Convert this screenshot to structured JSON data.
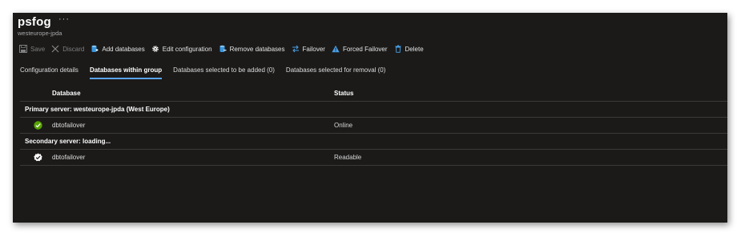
{
  "header": {
    "title": "psfog",
    "more_label": "···",
    "subtitle": "westeurope-jpda"
  },
  "toolbar": {
    "save": "Save",
    "discard": "Discard",
    "add_databases": "Add databases",
    "edit_configuration": "Edit configuration",
    "remove_databases": "Remove databases",
    "failover": "Failover",
    "forced_failover": "Forced Failover",
    "delete": "Delete"
  },
  "tabs": [
    {
      "label": "Configuration details",
      "active": false
    },
    {
      "label": "Databases within group",
      "active": true
    },
    {
      "label": "Databases selected to be added (0)",
      "active": false
    },
    {
      "label": "Databases selected for removal (0)",
      "active": false
    }
  ],
  "grid": {
    "columns": {
      "database": "Database",
      "status": "Status"
    },
    "groups": [
      {
        "label": "Primary server: westeurope-jpda (West Europe)",
        "rows": [
          {
            "name": "dbtofailover",
            "status": "Online",
            "icon": "check-circle-icon",
            "icon_color": "#57a300"
          }
        ]
      },
      {
        "label": "Secondary server: loading...",
        "rows": [
          {
            "name": "dbtofailover",
            "status": "Readable",
            "icon": "check-shield-icon",
            "icon_color": "#ffffff"
          }
        ]
      }
    ]
  },
  "colors": {
    "background": "#1b1a19",
    "accent": "#5aa3f0",
    "warning": "#4aa0e6"
  }
}
